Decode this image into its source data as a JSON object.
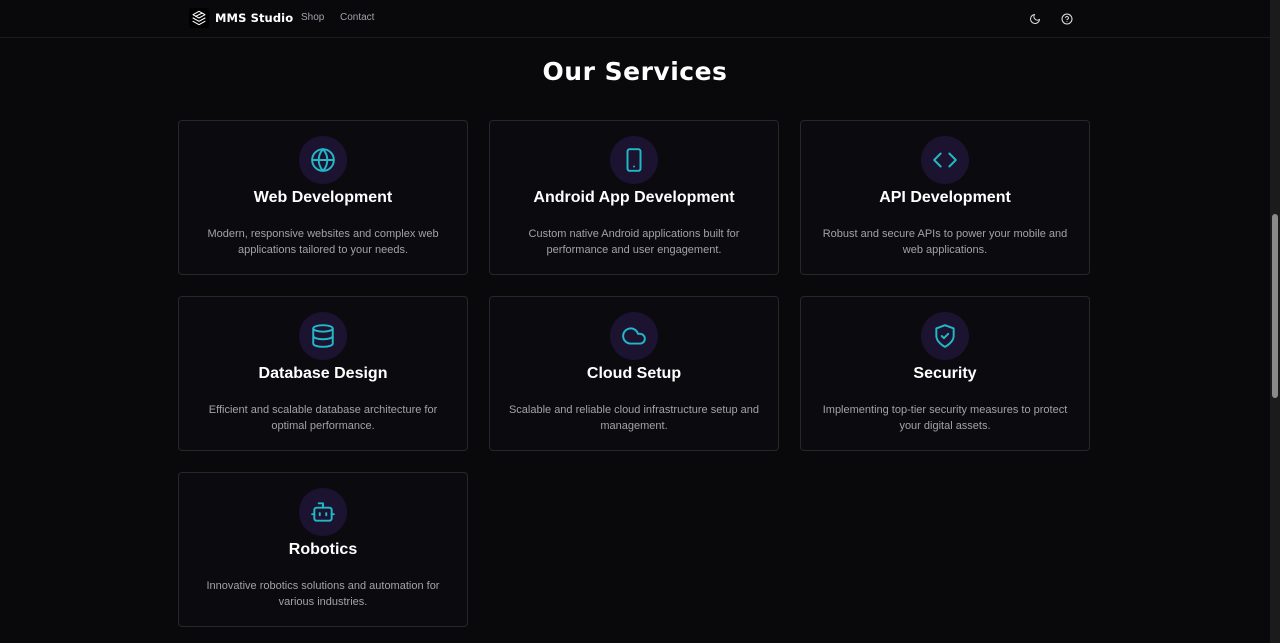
{
  "header": {
    "brand": "MMS Studio",
    "nav": [
      {
        "label": "Shop"
      },
      {
        "label": "Contact"
      }
    ],
    "icons": [
      "logo-icon",
      "moon-icon",
      "help-circle-icon"
    ]
  },
  "main": {
    "title": "Our Services",
    "services": [
      {
        "title": "Web Development",
        "description": "Modern, responsive websites and complex web applications tailored to your needs.",
        "icon": "globe-icon"
      },
      {
        "title": "Android App Development",
        "description": "Custom native Android applications built for performance and user engagement.",
        "icon": "smartphone-icon"
      },
      {
        "title": "API Development",
        "description": "Robust and secure APIs to power your mobile and web applications.",
        "icon": "code-icon"
      },
      {
        "title": "Database Design",
        "description": "Efficient and scalable database architecture for optimal performance.",
        "icon": "database-icon"
      },
      {
        "title": "Cloud Setup",
        "description": "Scalable and reliable cloud infrastructure setup and management.",
        "icon": "cloud-icon"
      },
      {
        "title": "Security",
        "description": "Implementing top-tier security measures to protect your digital assets.",
        "icon": "shield-check-icon"
      },
      {
        "title": "Robotics",
        "description": "Innovative robotics solutions and automation for various industries.",
        "icon": "bot-icon"
      }
    ]
  },
  "colors": {
    "background": "#09090b",
    "accent": "#22b8c8",
    "icon_bg": "#1c1331",
    "card_border": "#27272a",
    "muted_text": "#a1a1aa"
  }
}
